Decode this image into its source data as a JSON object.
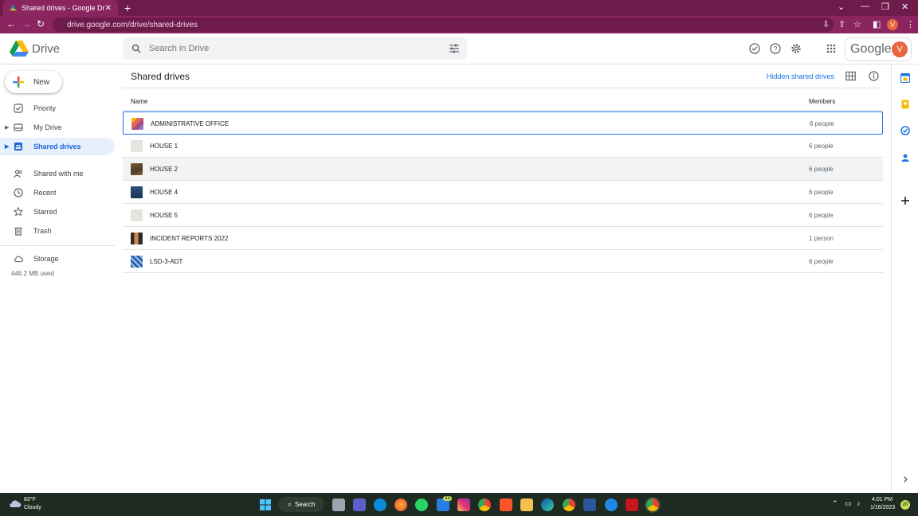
{
  "browser": {
    "tab_title": "Shared drives - Google Drive",
    "url": "drive.google.com/drive/shared-drives",
    "profile_initial": "V"
  },
  "header": {
    "app_name": "Drive",
    "search_placeholder": "Search in Drive",
    "google_wordmark": "Google",
    "account_initial": "V"
  },
  "sidebar": {
    "new_label": "New",
    "items": [
      {
        "label": "Priority",
        "icon": "priority-icon"
      },
      {
        "label": "My Drive",
        "icon": "my-drive-icon"
      },
      {
        "label": "Shared drives",
        "icon": "shared-drives-icon",
        "active": true
      },
      {
        "label": "Shared with me",
        "icon": "shared-with-me-icon"
      },
      {
        "label": "Recent",
        "icon": "clock-icon"
      },
      {
        "label": "Starred",
        "icon": "star-icon"
      },
      {
        "label": "Trash",
        "icon": "trash-icon"
      },
      {
        "label": "Storage",
        "icon": "cloud-icon"
      }
    ],
    "storage_used": "446.2 MB used"
  },
  "main": {
    "title": "Shared drives",
    "hidden_link": "Hidden shared drives",
    "columns": {
      "name": "Name",
      "members": "Members"
    },
    "rows": [
      {
        "name": "ADMINISTRATIVE OFFICE",
        "members": "6 people"
      },
      {
        "name": "HOUSE 1",
        "members": "6 people"
      },
      {
        "name": "HOUSE 2",
        "members": "6 people"
      },
      {
        "name": "HOUSE 4",
        "members": "6 people"
      },
      {
        "name": "HOUSE 5",
        "members": "6 people"
      },
      {
        "name": "INCIDENT REPORTS 2022",
        "members": "1 person"
      },
      {
        "name": "LSD-3-ADT",
        "members": "6 people"
      }
    ]
  },
  "taskbar": {
    "temperature": "83°F",
    "condition": "Cloudy",
    "search_label": "Search",
    "mail_badge": "33",
    "time": "4:01 PM",
    "date": "1/16/2023",
    "notification_count": "20"
  },
  "colors": {
    "chrome_tab_bar": "#6e1a4a",
    "chrome_toolbar": "#8a2560",
    "accent": "#1a73e8",
    "active_nav_bg": "#e8f0fe",
    "taskbar": "#1f2a20"
  }
}
